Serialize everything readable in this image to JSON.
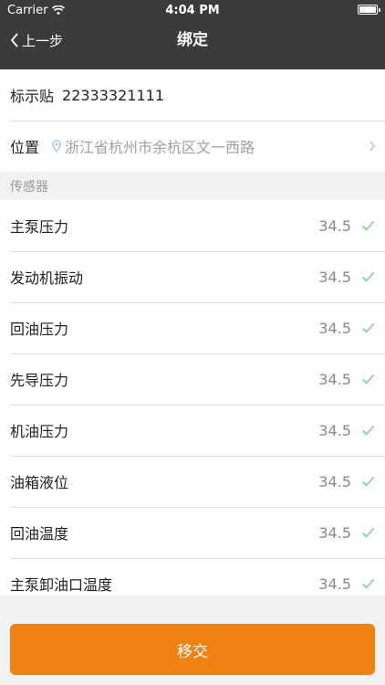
{
  "status_bar": {
    "carrier": "Carrier",
    "time": "4:04 PM"
  },
  "nav": {
    "back_label": "上一步",
    "title": "绑定"
  },
  "tag": {
    "label": "标示贴",
    "value": "22333321111"
  },
  "location": {
    "label": "位置",
    "value": "浙江省杭州市余杭区文一西路"
  },
  "sensors": {
    "header": "传感器",
    "items": [
      {
        "name": "主泵压力",
        "value": "34.5"
      },
      {
        "name": "发动机振动",
        "value": "34.5"
      },
      {
        "name": "回油压力",
        "value": "34.5"
      },
      {
        "name": "先导压力",
        "value": "34.5"
      },
      {
        "name": "机油压力",
        "value": "34.5"
      },
      {
        "name": "油箱液位",
        "value": "34.5"
      },
      {
        "name": "回油温度",
        "value": "34.5"
      },
      {
        "name": "主泵卸油口温度",
        "value": "34.5"
      }
    ]
  },
  "footer": {
    "submit_label": "移交"
  },
  "colors": {
    "accent": "#f08214",
    "navbar": "#3b3b3b",
    "check": "#7ed37e"
  }
}
